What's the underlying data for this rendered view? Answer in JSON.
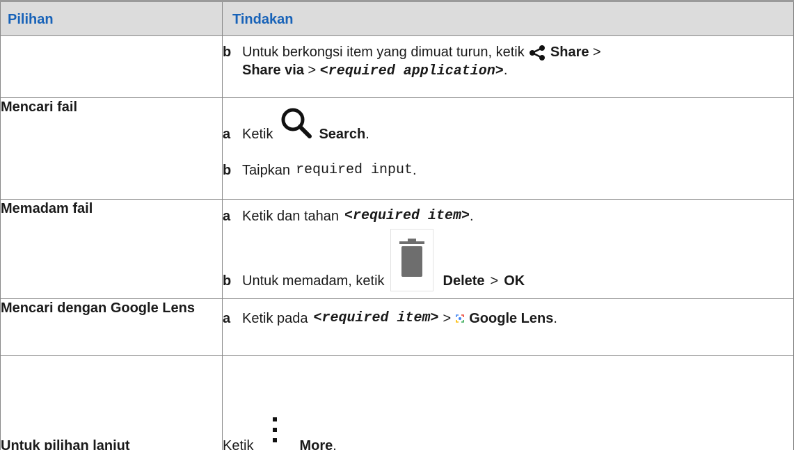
{
  "header": {
    "col1": "Pilihan",
    "col2": "Tindakan"
  },
  "rows": {
    "share": {
      "step_b": {
        "letter": "b",
        "text1": "Untuk berkongsi item yang dimuat turun, ketik",
        "share": "Share",
        "sep1": ">",
        "share_via": "Share via",
        "sep2": ">",
        "app": "<required application>",
        "end": "."
      }
    },
    "search": {
      "option": "Mencari fail",
      "step_a": {
        "letter": "a",
        "text": "Ketik",
        "label": "Search",
        "end": "."
      },
      "step_b": {
        "letter": "b",
        "text": "Taipkan",
        "code": "required input",
        "end": "."
      }
    },
    "delete": {
      "option": "Memadam fail",
      "step_a": {
        "letter": "a",
        "text": "Ketik dan tahan",
        "item": "<required item>",
        "end": "."
      },
      "step_b": {
        "letter": "b",
        "text": "Untuk memadam, ketik",
        "label": "Delete",
        "sep": ">",
        "ok": "OK"
      }
    },
    "lens": {
      "option": "Mencari dengan Google Lens",
      "step_a": {
        "letter": "a",
        "text": "Ketik pada",
        "item": "<required item>",
        "sep": ">",
        "label": "Google Lens",
        "end": "."
      }
    },
    "more": {
      "option": "Untuk pilihan lanjut",
      "text": "Ketik",
      "label": "More",
      "end": "."
    }
  },
  "icons": [
    "share-icon",
    "search-icon",
    "delete-icon",
    "google-lens-icon",
    "more-vert-icon"
  ],
  "colors": {
    "header_text": "#1762b8",
    "header_bg": "#dcdcdc",
    "border": "#888888"
  }
}
